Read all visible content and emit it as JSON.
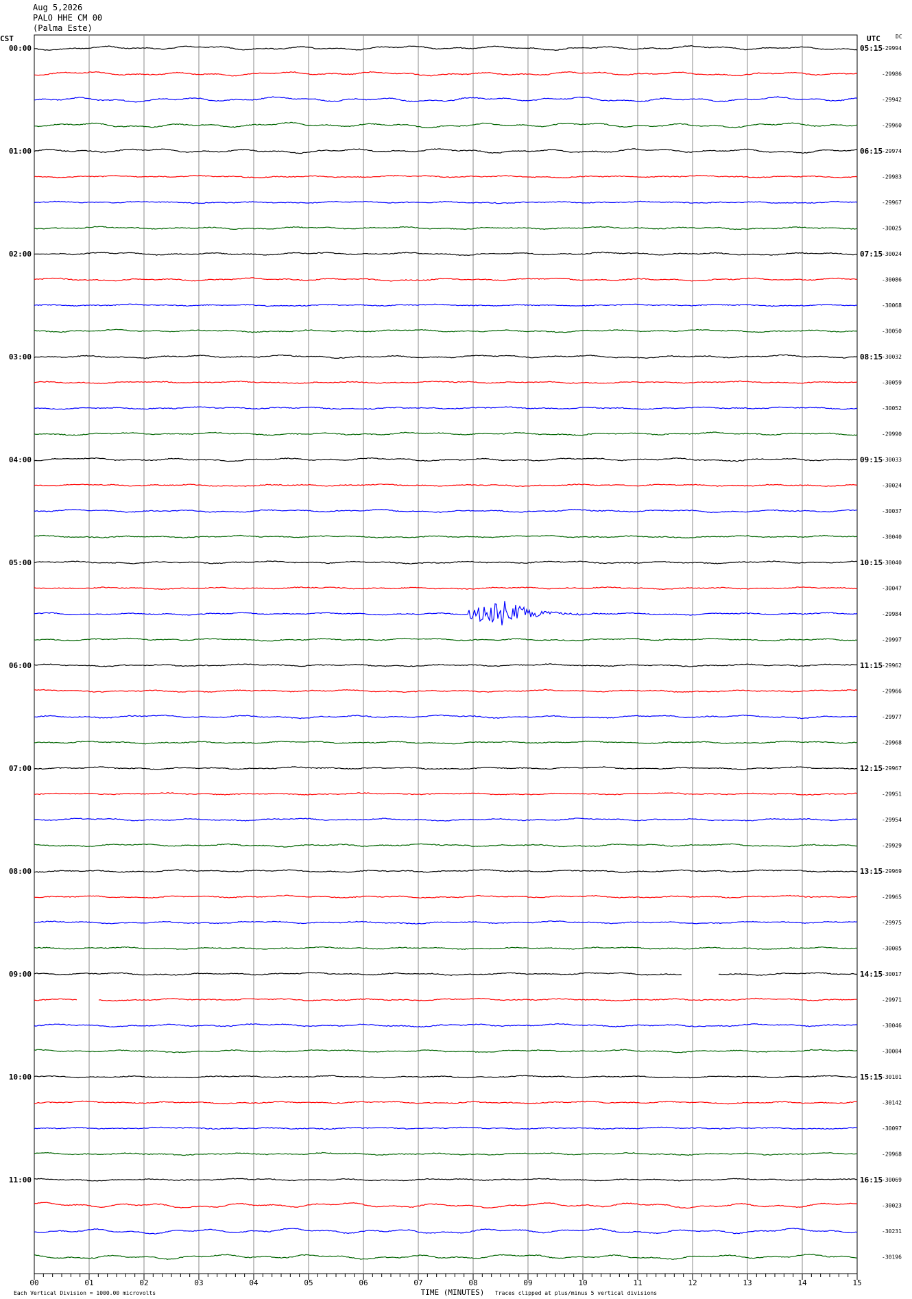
{
  "header": {
    "date": "Aug 5,2026",
    "station": "PALO HHE CM 00",
    "location": "(Palma Este)"
  },
  "left_zone": "CST",
  "right_zone": "UTC",
  "dc_label": "DC",
  "footer": {
    "scale": "Each Vertical Division = 1000.00 microvolts",
    "xlabel": "TIME (MINUTES)",
    "clip": "Traces clipped at plus/minus 5 vertical divisions"
  },
  "chart_data": {
    "type": "line",
    "xlabel": "TIME (MINUTES)",
    "xlim": [
      0,
      15
    ],
    "x_ticks": [
      "00",
      "01",
      "02",
      "03",
      "04",
      "05",
      "06",
      "07",
      "08",
      "09",
      "10",
      "11",
      "12",
      "13",
      "14",
      "15"
    ],
    "minutes_per_line": 15,
    "line_colors": [
      "#000000",
      "#ff0000",
      "#0000ff",
      "#006400"
    ],
    "left_hour_labels": [
      "00:00",
      "01:00",
      "02:00",
      "03:00",
      "04:00",
      "05:00",
      "06:00",
      "07:00",
      "08:00",
      "09:00",
      "10:00",
      "11:00"
    ],
    "right_hour_labels": [
      "05:15",
      "06:15",
      "07:15",
      "08:15",
      "09:15",
      "10:15",
      "11:15",
      "12:15",
      "13:15",
      "14:15",
      "15:15",
      "16:15"
    ],
    "dc_offsets": [
      "-29994",
      "-29986",
      "-29942",
      "-29960",
      "-29974",
      "-29983",
      "-29967",
      "-30025",
      "-30024",
      "-30086",
      "-30068",
      "-30050",
      "-30032",
      "-30059",
      "-30052",
      "-29990",
      "-30033",
      "-30024",
      "-30037",
      "-30040",
      "-30040",
      "-30047",
      "-29984",
      "-29997",
      "-29962",
      "-29966",
      "-29977",
      "-29968",
      "-29967",
      "-29951",
      "-29954",
      "-29929",
      "-29969",
      "-29965",
      "-29975",
      "-30005",
      "-30017",
      "-29971",
      "-30046",
      "-30004",
      "-30101",
      "-30142",
      "-30097",
      "-29968",
      "-30069",
      "-30023",
      "-30231",
      "-30196"
    ],
    "events": [
      {
        "line": 22,
        "start_min": 7.9,
        "peak_min": 8.55,
        "end_min": 11.2
      }
    ],
    "gaps": [
      {
        "line": 36,
        "start_min": 11.8,
        "end_min": 12.45
      },
      {
        "line": 37,
        "start_min": 0.8,
        "end_min": 1.15
      }
    ]
  }
}
